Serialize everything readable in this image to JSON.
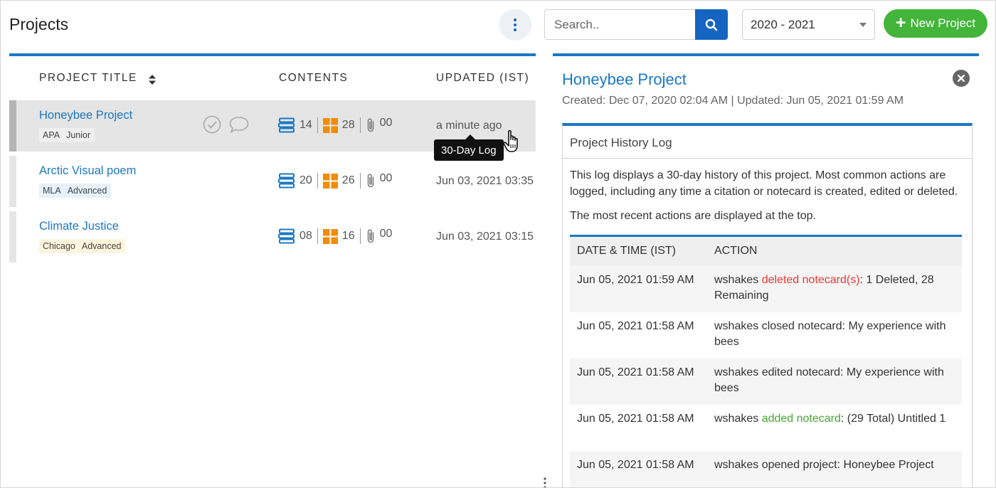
{
  "header": {
    "title": "Projects",
    "search_placeholder": "Search..",
    "year": "2020 - 2021",
    "new_project_label": "New Project"
  },
  "table": {
    "columns": {
      "title": "PROJECT TITLE",
      "contents": "CONTENTS",
      "updated": "UPDATED (IST)"
    },
    "rows": [
      {
        "title": "Honeybee Project",
        "style": "APA",
        "level": "Junior",
        "citations": "14",
        "notecards": "28",
        "attachments": "00",
        "updated": "a minute ago"
      },
      {
        "title": "Arctic Visual poem",
        "style": "MLA",
        "level": "Advanced",
        "citations": "20",
        "notecards": "26",
        "attachments": "00",
        "updated": "Jun 03, 2021 03:35"
      },
      {
        "title": "Climate Justice",
        "style": "Chicago",
        "level": "Advanced",
        "citations": "08",
        "notecards": "16",
        "attachments": "00",
        "updated": "Jun 03, 2021 03:15"
      }
    ],
    "tooltip": "30-Day Log"
  },
  "detail": {
    "title": "Honeybee Project",
    "meta": "Created: Dec 07, 2020 02:04 AM | Updated: Jun 05, 2021 01:59 AM",
    "log_title": "Project History Log",
    "desc1": "This log displays a 30-day history of this project. Most common actions are logged, including any time a citation or notecard is created, edited or deleted.",
    "desc2": "The most recent actions are displayed at the top.",
    "log_columns": {
      "datetime": "DATE & TIME (IST)",
      "action": "ACTION"
    },
    "log_rows": [
      {
        "date": "Jun 05, 2021 01:59 AM",
        "user": "wshakes",
        "verb": "deleted notecard(s)",
        "rest": ": 1 Deleted, 28 Remaining"
      },
      {
        "date": "Jun 05, 2021 01:58 AM",
        "text": "wshakes closed notecard: My experience with bees"
      },
      {
        "date": "Jun 05, 2021 01:58 AM",
        "text": "wshakes edited notecard: My experience with bees"
      },
      {
        "date": "Jun 05, 2021 01:58 AM",
        "user": "wshakes",
        "verb": "added notecard",
        "rest": ": (29 Total) Untitled 1"
      },
      {
        "date": "Jun 05, 2021 01:58 AM",
        "text": "wshakes opened project: Honeybee Project"
      }
    ]
  },
  "colors": {
    "accent_blue": "#1b78c2",
    "button_blue": "#1565c0",
    "new_project_green": "#43b53a",
    "citation_icon": "#1b78c2",
    "notecard_icon": "#f28c00",
    "delete_red": "#e53935",
    "add_green": "#43a72f"
  }
}
